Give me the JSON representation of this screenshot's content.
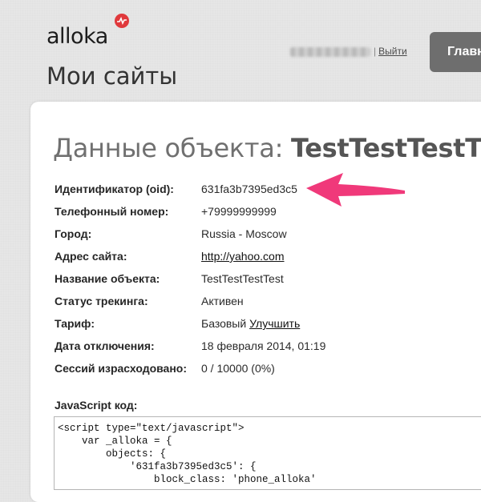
{
  "header": {
    "logo_text": "alloka",
    "logout_link": "Выйти",
    "main_button": "Главн",
    "page_title": "Мои сайты"
  },
  "card": {
    "title_prefix": "Данные объекта:",
    "title_name": "TestTestTestT"
  },
  "details": {
    "oid": {
      "label": "Идентификатор (oid):",
      "value": "631fa3b7395ed3c5"
    },
    "phone": {
      "label": "Телефонный номер:",
      "value": "+79999999999"
    },
    "city": {
      "label": "Город:",
      "value": "Russia - Moscow"
    },
    "site": {
      "label": "Адрес сайта:",
      "value": "http://yahoo.com"
    },
    "name": {
      "label": "Название объекта:",
      "value": "TestTestTestTest"
    },
    "status": {
      "label": "Статус трекинга:",
      "value": "Активен"
    },
    "tariff": {
      "label": "Тариф:",
      "value": "Базовый",
      "upgrade_link": "Улучшить"
    },
    "disable_date": {
      "label": "Дата отключения:",
      "value": "18 февраля 2014, 01:19"
    },
    "sessions": {
      "label": "Сессий израсходовано:",
      "value": "0 / 10000 (0%)"
    }
  },
  "js_code": {
    "label": "JavaScript код:",
    "code": "<script type=\"text/javascript\">\n    var _alloka = {\n        objects: {\n            '631fa3b7395ed3c5': {\n                block_class: 'phone_alloka'"
  },
  "colors": {
    "arrow": "#f0397a",
    "logo_badge": "#e0393c",
    "main_button": "#6e6e6e"
  }
}
